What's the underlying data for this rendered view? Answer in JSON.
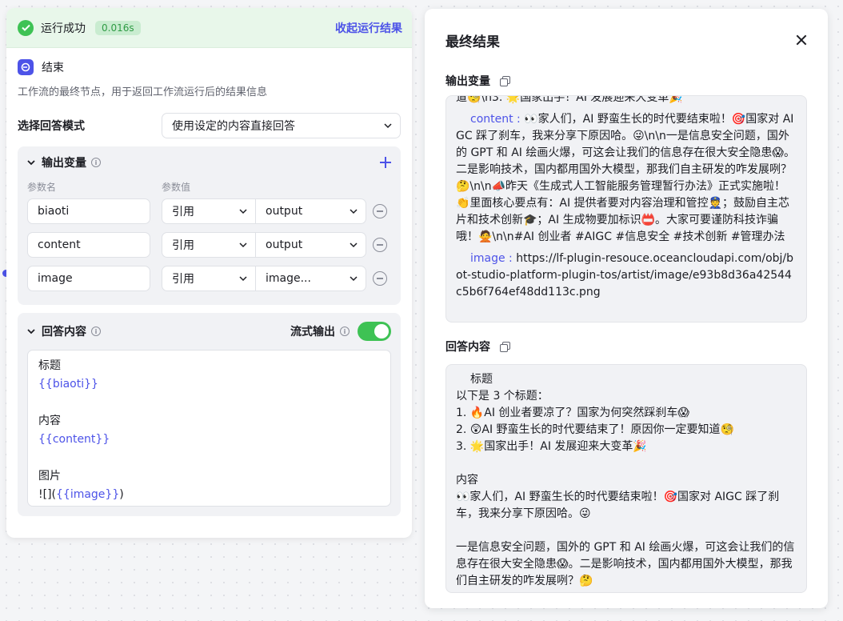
{
  "run": {
    "status": "运行成功",
    "duration": "0.016s",
    "collapse_label": "收起运行结果"
  },
  "node": {
    "title": "结束",
    "description": "工作流的最终节点，用于返回工作流运行后的结果信息"
  },
  "mode": {
    "label": "选择回答模式",
    "value": "使用设定的内容直接回答"
  },
  "output_vars": {
    "title": "输出变量",
    "col_name": "参数名",
    "col_value": "参数值",
    "rows": [
      {
        "name": "biaoti",
        "ref": "引用",
        "value": "output"
      },
      {
        "name": "content",
        "ref": "引用",
        "value": "output"
      },
      {
        "name": "image",
        "ref": "引用",
        "value": "image..."
      }
    ]
  },
  "answer": {
    "title": "回答内容",
    "stream_label": "流式输出",
    "stream_on": true,
    "lines": {
      "l1": "标题",
      "l2": "{{biaoti}}",
      "l3": "内容",
      "l4": "{{content}}",
      "l5": "图片",
      "l6_prefix": "![](",
      "l6_var": "{{image}}",
      "l6_suffix": ")"
    }
  },
  "result": {
    "title": "最终结果",
    "output_label": "输出变量",
    "answer_label": "回答内容",
    "output_partial_top": "道🧐\\n3. 🌟国家出手！AI 发展迎来大变革🎉",
    "content_key": "content :",
    "content_value": "👀家人们，AI 野蛮生长的时代要结束啦！🎯国家对 AIGC 踩了刹车，我来分享下原因哈。😜\\n\\n一是信息安全问题，国外的 GPT 和 AI 绘画火爆，可这会让我们的信息存在很大安全隐患😱。二是影响技术，国内都用国外大模型，那我们自主研发的咋发展咧？🤔\\n\\n📣昨天《生成式人工智能服务管理暂行办法》正式实施啦！👏里面核心要点有：AI 提供者要对内容治理和管控👮；鼓励自主芯片和技术创新🎓；AI 生成物要加标识📛。大家可要谨防科技诈骗哦！🙅\\n\\n#AI 创业者 #AIGC #信息安全 #技术创新 #管理办法",
    "image_key": "image :",
    "image_value": "https://lf-plugin-resouce.oceancloudapi.com/obj/bot-studio-platform-plugin-tos/artist/image/e93b8d36a42544c5b6f764ef48dd113c.png",
    "answer_text": {
      "t1": "标题",
      "t2": "以下是 3 个标题：",
      "t3": "1. 🔥AI 创业者要凉了？国家为何突然踩刹车😱",
      "t4": "2. 😲AI 野蛮生长的时代要结束了！原因你一定要知道🧐",
      "t5": "3. 🌟国家出手！AI 发展迎来大变革🎉",
      "t6": "内容",
      "t7": "👀家人们，AI 野蛮生长的时代要结束啦！🎯国家对 AIGC 踩了刹车，我来分享下原因哈。😜",
      "t8": "一是信息安全问题，国外的 GPT 和 AI 绘画火爆，可这会让我们的信息存在很大安全隐患😱。二是影响技术，国内都用国外大模型，那我们自主研发的咋发展咧？🤔"
    }
  },
  "colors": {
    "accent": "#4d53e8",
    "success": "#3ec254"
  }
}
